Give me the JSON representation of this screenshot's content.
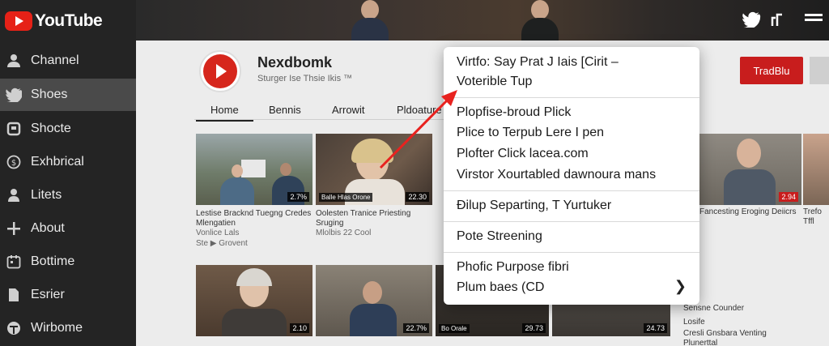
{
  "sidebar": {
    "logo": "YouTube",
    "items": [
      {
        "label": "Channel",
        "icon": "person-icon"
      },
      {
        "label": "Shoes",
        "icon": "bird-icon"
      },
      {
        "label": "Shocte",
        "icon": "box-icon"
      },
      {
        "label": "Exhbrical",
        "icon": "dollar-icon"
      },
      {
        "label": "Litets",
        "icon": "person-icon"
      },
      {
        "label": "About",
        "icon": "plus-icon"
      },
      {
        "label": "Bottime",
        "icon": "calendar-icon"
      },
      {
        "label": "Esrier",
        "icon": "file-icon"
      },
      {
        "label": "Wirbome",
        "icon": "globe-icon"
      }
    ]
  },
  "header": {
    "icons": [
      "twitter-icon",
      "link-icon",
      "menu-icon"
    ]
  },
  "channel": {
    "name": "Nexdbomk",
    "subtitle": "Sturger Ise Thsie Ikis ™",
    "subscribe_label": "TradBlu"
  },
  "tabs": [
    "Home",
    "Bennis",
    "Arrowit",
    "Pldoature"
  ],
  "videos": [
    {
      "title": "Lestise Bracknd Tuegng Credes Mlengatien",
      "meta": "Vonlice Lals",
      "meta2": "Ste ▶ Grovent",
      "duration": "2.7%"
    },
    {
      "title": "Oolesten Tranice Priesting Sruging",
      "meta": "Mlolbis 22 Cool",
      "caption": "Balle Hlas Orone",
      "duration": "22.30"
    },
    {
      "title": "",
      "meta": "",
      "duration": "2.10"
    },
    {
      "title": "",
      "meta": "",
      "duration": "22.7%"
    },
    {
      "title": "",
      "meta": "",
      "caption": "Bo Orale",
      "duration": "29.73"
    },
    {
      "title": "",
      "meta": "",
      "duration": "24.73"
    }
  ],
  "right_videos": [
    {
      "title": "Fancesting Eroging Deiicrs",
      "duration": "2.94"
    },
    {
      "title": "Trefo Tffl",
      "duration": ""
    }
  ],
  "side_list": [
    "Sensne Counder",
    "Losife",
    "Cresli Gnsbara Venting",
    "Plunerttal"
  ],
  "context_menu": {
    "items": [
      {
        "label": "Virtfo: Say Prat J Iais [Cirit –"
      },
      {
        "label": "Voterible Tup"
      },
      {
        "label": "Plopfise-broud Plick"
      },
      {
        "label": "Plice to Terpub Lere I pen"
      },
      {
        "label": "Plofter Click lacea.com"
      },
      {
        "label": "Virstor Xourtabled dawnoura mans"
      },
      {
        "label": "Ðilup Separting, T Yurtuker"
      },
      {
        "label": "Pote Streening"
      },
      {
        "label": "Phofic Purpose fibri"
      },
      {
        "label": "Plum baes (CD"
      }
    ]
  },
  "colors": {
    "accent": "#d6261c",
    "sidebar": "#242424",
    "active": "#4a4a4a",
    "arrow": "#e8221f"
  }
}
